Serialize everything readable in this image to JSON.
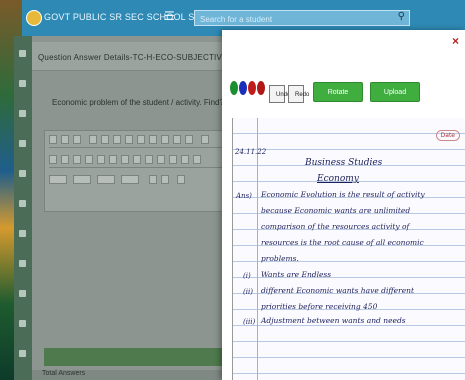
{
  "topbar": {
    "org_title": "GOVT PUBLIC SR SEC SCHOOL SAMBHAL",
    "search_placeholder": "Search for a student"
  },
  "question": {
    "title": "Question Answer Details-TC-H-ECO-SUBJECTIVE",
    "prompt": "Economic problem of the student / activity. Find?",
    "footer": "Total Answers"
  },
  "popup": {
    "buttons": {
      "undo": "Undo",
      "redo": "Redo",
      "rotate": "Rotate Image",
      "upload": "Upload Image"
    },
    "colors": [
      "#1a8f2d",
      "#1b2fb8",
      "#c21b1b",
      "#b01818"
    ]
  },
  "notebook": {
    "date": "24.11.22",
    "badge": "Date",
    "title_1": "Business Studies",
    "title_2": "Economy",
    "lines": [
      "Economic Evolution is the result of activity",
      "because Economic wants are unlimited",
      "comparison of the resources activity of",
      "resources is the root cause of all economic",
      "problems.",
      "Wants are Endless",
      "different Economic wants have different",
      "priorities before receiving 450",
      "Adjustment between wants and needs"
    ],
    "margin_labels": [
      "Ans)",
      "(i)",
      "(ii)",
      "(iii)"
    ]
  }
}
